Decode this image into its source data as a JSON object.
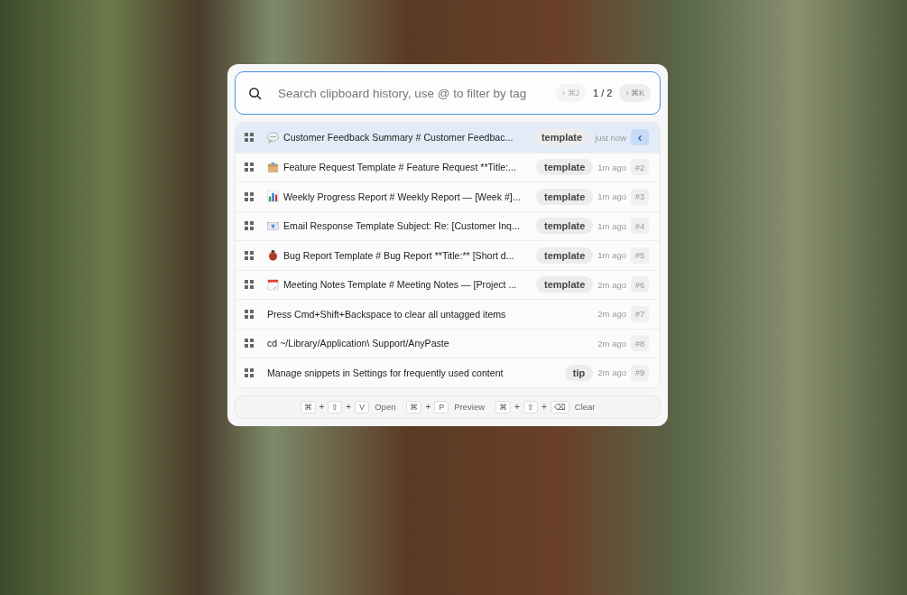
{
  "search": {
    "placeholder": "Search clipboard history, use @ to filter by tag",
    "prev": {
      "arrow": "‹",
      "key": "⌘J",
      "disabled": true
    },
    "page": "1 / 2",
    "next": {
      "arrow": "›",
      "key": "⌘K",
      "disabled": false
    }
  },
  "items": [
    {
      "kind": "speech",
      "text": "Customer Feedback Summary # Customer Feedbac...",
      "tag": "template",
      "time": "just now",
      "number": "‹",
      "selected": true
    },
    {
      "kind": "box",
      "text": "Feature Request Template # Feature Request **Title:...",
      "tag": "template",
      "time": "1m ago",
      "number": "#2",
      "selected": false
    },
    {
      "kind": "chart",
      "text": "Weekly Progress Report # Weekly Report — [Week #]...",
      "tag": "template",
      "time": "1m ago",
      "number": "#3",
      "selected": false
    },
    {
      "kind": "email",
      "text": "Email Response Template Subject: Re: [Customer Inq...",
      "tag": "template",
      "time": "1m ago",
      "number": "#4",
      "selected": false
    },
    {
      "kind": "bug",
      "text": "Bug Report Template # Bug Report **Title:** [Short d...",
      "tag": "template",
      "time": "1m ago",
      "number": "#5",
      "selected": false
    },
    {
      "kind": "calendar",
      "text": "Meeting Notes Template # Meeting Notes — [Project ...",
      "tag": "template",
      "time": "2m ago",
      "number": "#6",
      "selected": false
    },
    {
      "kind": "plain",
      "text": "Press Cmd+Shift+Backspace to clear all untagged items",
      "time": "2m ago",
      "number": "#7",
      "selected": false
    },
    {
      "kind": "plain",
      "text": "cd ~/Library/Application\\ Support/AnyPaste",
      "time": "2m ago",
      "number": "#8",
      "selected": false
    },
    {
      "kind": "plain",
      "text": "Manage snippets in Settings for frequently used content",
      "tag": "tip",
      "time": "2m ago",
      "number": "#9",
      "selected": false
    }
  ],
  "shortcuts": [
    {
      "keys": [
        "⌘",
        "⇧",
        "V"
      ],
      "label": "Open"
    },
    {
      "keys": [
        "⌘",
        "P"
      ],
      "label": "Preview"
    },
    {
      "keys": [
        "⌘",
        "⇧",
        "⌫"
      ],
      "label": "Clear"
    }
  ],
  "plus": "+"
}
